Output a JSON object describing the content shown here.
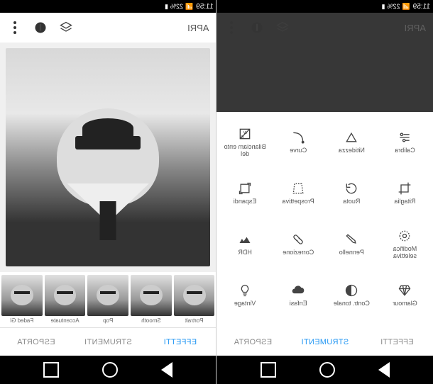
{
  "status": {
    "time": "11:59",
    "battery": "22%"
  },
  "header": {
    "open": "APRI"
  },
  "tools": [
    {
      "name": "calibra",
      "label": "Calibra",
      "icon": "tune"
    },
    {
      "name": "nitidezza",
      "label": "Nitidezza",
      "icon": "triangle"
    },
    {
      "name": "curve",
      "label": "Curve",
      "icon": "curve"
    },
    {
      "name": "bilanciamento",
      "label": "Bilanciam ento del",
      "icon": "wb"
    },
    {
      "name": "ritaglia",
      "label": "Ritaglia",
      "icon": "crop"
    },
    {
      "name": "ruota",
      "label": "Ruota",
      "icon": "rotate"
    },
    {
      "name": "prospettiva",
      "label": "Prospettiva",
      "icon": "perspective"
    },
    {
      "name": "espandi",
      "label": "Espandi",
      "icon": "expand"
    },
    {
      "name": "modifica-selettiva",
      "label": "Modifica selettiva",
      "icon": "target"
    },
    {
      "name": "pennello",
      "label": "Pennello",
      "icon": "brush"
    },
    {
      "name": "correzione",
      "label": "Correzione",
      "icon": "heal"
    },
    {
      "name": "hdr",
      "label": "HDR",
      "icon": "hdr"
    },
    {
      "name": "glamour",
      "label": "Glamour",
      "icon": "diamond"
    },
    {
      "name": "contr-tonale",
      "label": "Contr. tonale",
      "icon": "contrast"
    },
    {
      "name": "enfasi",
      "label": "Enfasi",
      "icon": "cloud"
    },
    {
      "name": "vintage",
      "label": "Vintage",
      "icon": "bulb"
    },
    {
      "name": "extra1",
      "label": "",
      "icon": "dice"
    },
    {
      "name": "extra2",
      "label": "",
      "icon": "mustache"
    },
    {
      "name": "extra3",
      "label": "",
      "icon": "sun"
    },
    {
      "name": "extra4",
      "label": "",
      "icon": "mountains"
    }
  ],
  "filters": [
    {
      "name": "portrait",
      "label": "Portrait"
    },
    {
      "name": "smooth",
      "label": "Smooth"
    },
    {
      "name": "pop",
      "label": "Pop"
    },
    {
      "name": "accentuate",
      "label": "Accentuate"
    },
    {
      "name": "faded-gl",
      "label": "Faded Gl"
    }
  ],
  "tabs": {
    "effetti": "EFFETTI",
    "strumenti": "STRUMENTI",
    "esporta": "ESPORTA"
  }
}
